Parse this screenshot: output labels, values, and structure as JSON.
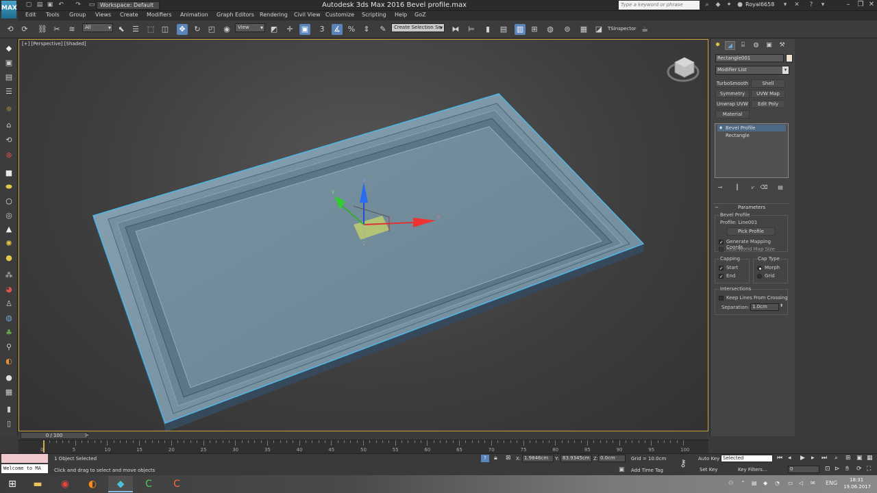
{
  "titlebar": {
    "app_logo": "MAX",
    "workspace": "Workspace: Default",
    "title": "Autodesk 3ds Max 2016    Bevel profile.max",
    "search_placeholder": "Type a keyword or phrase",
    "user": "Royal6658"
  },
  "menus": [
    "Edit",
    "Tools",
    "Group",
    "Views",
    "Create",
    "Modifiers",
    "Animation",
    "Graph Editors",
    "Rendering",
    "Civil View",
    "Customize",
    "Scripting",
    "Help",
    "GoZ"
  ],
  "toolbar": {
    "filter": "All",
    "refcoord": "View",
    "selection_set": "Create Selection Se",
    "ts_inspector": "TSInspector"
  },
  "viewport": {
    "label": "[+] [Perspective] [Shaded]",
    "gizmo_x": "x",
    "gizmo_y": "y",
    "gizmo_z": "z"
  },
  "command_panel": {
    "object_name": "Rectangle001",
    "object_color": "#f3e1cf",
    "modifier_list": "Modifier List",
    "mod_buttons": [
      "TurboSmooth",
      "Shell",
      "Symmetry",
      "UVW Map",
      "Unwrap UVW",
      "Edit Poly",
      "Material"
    ],
    "stack": [
      {
        "label": "Bevel Profile",
        "selected": true
      },
      {
        "label": "Rectangle",
        "selected": false
      }
    ],
    "parameters": {
      "title": "Parameters",
      "group_bevel": "Bevel Profile",
      "profile": "Profile: Line001",
      "pick_profile": "Pick Profile",
      "gen_mapping": "Generate Mapping Coords.",
      "gen_mapping_checked": true,
      "real_world": "Real-World Map Size",
      "real_world_checked": false,
      "capping_title": "Capping",
      "cap_start": "Start",
      "cap_end": "End",
      "captype_title": "Cap Type",
      "morph": "Morph",
      "grid": "Grid",
      "intersections_title": "Intersections",
      "keep_lines": "Keep Lines From Crossing",
      "separation_label": "Separation:",
      "separation_value": "1.0cm"
    }
  },
  "timeline": {
    "frame_display": "0 / 100",
    "ticks": [
      "0",
      "5",
      "10",
      "15",
      "20",
      "25",
      "30",
      "35",
      "40",
      "45",
      "50",
      "55",
      "60",
      "65",
      "70",
      "75",
      "80",
      "85",
      "90",
      "95",
      "100"
    ]
  },
  "status": {
    "listener": "Welcome to MA",
    "objects_selected": "1 Object Selected",
    "prompt": "Click and drag to select and move objects",
    "x_label": "X:",
    "x_value": "1.9846cm",
    "y_label": "Y:",
    "y_value": "83.9345cm",
    "z_label": "Z:",
    "z_value": "0.0cm",
    "grid": "Grid = 10.0cm",
    "add_time_tag": "Add Time Tag",
    "auto_key": "Auto Key",
    "set_key": "Set Key",
    "selected": "Selected",
    "key_filters": "Key Filters...",
    "frame": "0"
  },
  "taskbar": {
    "lang": "ENG",
    "time": "18:31",
    "date": "19.06.2017"
  }
}
